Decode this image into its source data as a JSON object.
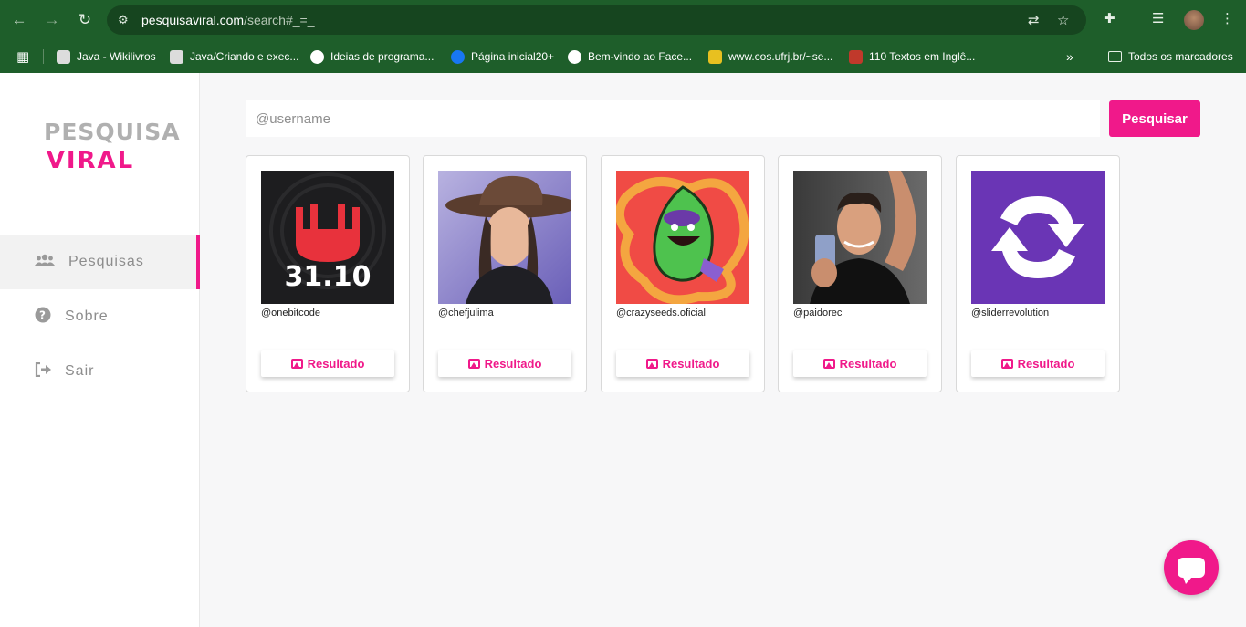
{
  "browser": {
    "url_host": "pesquisaviral.com",
    "url_path": "/search#_=_",
    "bookmarks": [
      {
        "label": "Java - Wikilivros",
        "icon": "wikibooks-icon"
      },
      {
        "label": "Java/Criando e exec...",
        "icon": "wikibooks-icon"
      },
      {
        "label": "Ideias de programa...",
        "icon": "site-icon"
      },
      {
        "label": "Página inicial20+",
        "icon": "facebook-icon"
      },
      {
        "label": "Bem-vindo ao Face...",
        "icon": "globe-icon"
      },
      {
        "label": "www.cos.ufrj.br/~se...",
        "icon": "site-icon"
      },
      {
        "label": "110 Textos em Inglê...",
        "icon": "site-icon"
      }
    ],
    "all_bookmarks_label": "Todos os marcadores"
  },
  "sidebar": {
    "logo_line1": "PESQUISA",
    "logo_line2": "VIRAL",
    "items": [
      {
        "label": "Pesquisas",
        "icon": "users-icon",
        "active": true
      },
      {
        "label": "Sobre",
        "icon": "question-circle-icon",
        "active": false
      },
      {
        "label": "Sair",
        "icon": "sign-out-icon",
        "active": false
      }
    ]
  },
  "search": {
    "placeholder": "@username",
    "button_label": "Pesquisar"
  },
  "cards": [
    {
      "username": "@onebitcode",
      "button_label": "Resultado",
      "image_label": "31.10"
    },
    {
      "username": "@chefjulima",
      "button_label": "Resultado"
    },
    {
      "username": "@crazyseeds.oficial",
      "button_label": "Resultado"
    },
    {
      "username": "@paidorec",
      "button_label": "Resultado"
    },
    {
      "username": "@sliderrevolution",
      "button_label": "Resultado"
    }
  ],
  "colors": {
    "accent": "#f0198a",
    "browser_green": "#1e5e2a",
    "slider_purple": "#6a35b5"
  }
}
